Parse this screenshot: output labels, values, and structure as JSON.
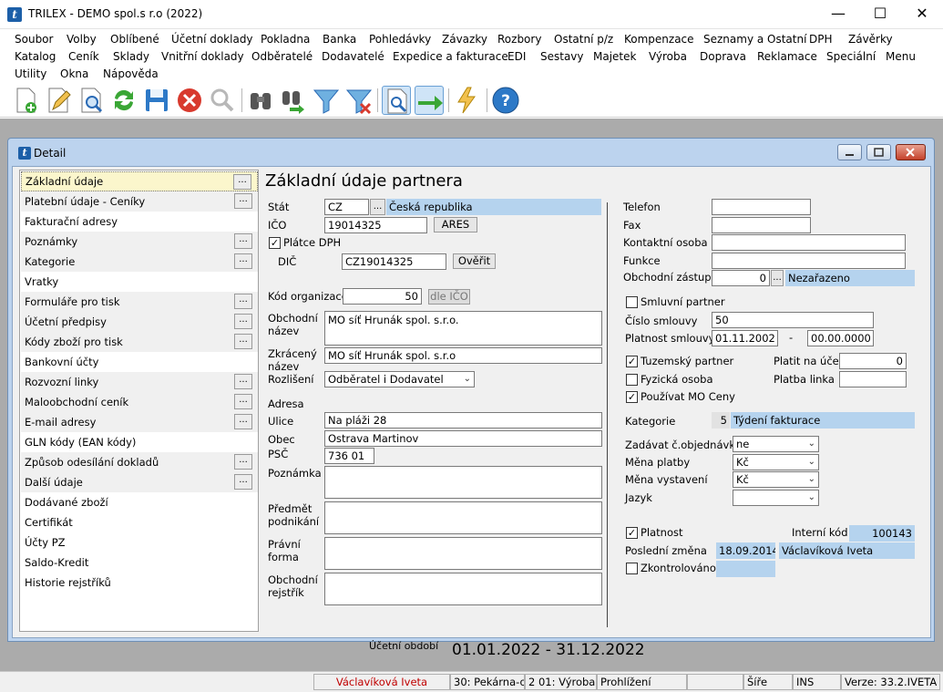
{
  "window": {
    "title": "TRILEX - DEMO spol.s r.o (2022)",
    "app_icon": "t"
  },
  "menu": {
    "row1": [
      "Soubor",
      "Volby",
      "Oblíbené",
      "Účetní doklady",
      "Pokladna",
      "Banka",
      "Pohledávky",
      "Závazky",
      "Rozbory",
      "Ostatní p/z",
      "Kompenzace",
      "Seznamy a Ostatní",
      "DPH",
      "Závěrky"
    ],
    "row2": [
      "Katalog",
      "Ceník",
      "Sklady",
      "Vnitřní doklady",
      "Odběratelé",
      "Dodavatelé",
      "Expedice a fakturace",
      "EDI",
      "Sestavy",
      "Majetek",
      "Výroba",
      "Doprava",
      "Reklamace",
      "Speciální",
      "Menu"
    ],
    "row3": [
      "Utility",
      "Okna",
      "Nápověda"
    ]
  },
  "toolbar": {
    "icons": [
      "new-record-icon",
      "edit-icon",
      "preview-icon",
      "refresh-icon",
      "save-icon",
      "delete-icon",
      "search-disabled-icon",
      "find-icon",
      "find-next-icon",
      "filter-icon",
      "remove-filter-icon",
      "document-search-icon",
      "green-arrow-icon",
      "lightning-icon",
      "help-icon"
    ]
  },
  "detail": {
    "title": "Detail",
    "icon": "t",
    "heading": "Základní údaje partnera",
    "nav": [
      {
        "label": "Základní údaje",
        "btn": "..."
      },
      {
        "label": "Platební údaje - Ceníky",
        "btn": "..."
      },
      {
        "label": "Fakturační adresy",
        "btn": ""
      },
      {
        "label": "Poznámky",
        "btn": "..."
      },
      {
        "label": "Kategorie",
        "btn": "..."
      },
      {
        "label": "Vratky",
        "btn": ""
      },
      {
        "label": "Formuláře pro tisk",
        "btn": "..."
      },
      {
        "label": "Účetní předpisy",
        "btn": "..."
      },
      {
        "label": "Kódy zboží pro tisk",
        "btn": "..."
      },
      {
        "label": "Bankovní účty",
        "btn": ""
      },
      {
        "label": "Rozvozní linky",
        "btn": "..."
      },
      {
        "label": "Maloobchodní ceník",
        "btn": "..."
      },
      {
        "label": "E-mail adresy",
        "btn": "..."
      },
      {
        "label": "GLN kódy (EAN kódy)",
        "btn": ""
      },
      {
        "label": "Způsob odesílání dokladů",
        "btn": "..."
      },
      {
        "label": "Další údaje",
        "btn": "..."
      },
      {
        "label": "Dodávané zboží",
        "btn": ""
      },
      {
        "label": "Certifikát",
        "btn": ""
      },
      {
        "label": "Účty PZ",
        "btn": ""
      },
      {
        "label": "Saldo-Kredit",
        "btn": ""
      },
      {
        "label": "Historie rejstříků",
        "btn": ""
      }
    ],
    "left": {
      "stat_label": "Stát",
      "stat_value": "CZ",
      "stat_btn": "...",
      "stat_name": "Česká republika",
      "ico_label": "IČO",
      "ico_value": "19014325",
      "ares_btn": "ARES",
      "platce_dph_label": "Plátce DPH",
      "platce_dph_checked": "✓",
      "dic_label": "DIČ",
      "dic_value": "CZ19014325",
      "overit_btn": "Ověřit",
      "kod_org_label": "Kód organizace",
      "kod_org_value": "50",
      "dle_ico_btn": "dle IČO",
      "obch_nazev_label": "Obchodní\nnázev",
      "obch_nazev_value": "MO síť Hrunák spol. s.r.o.",
      "zkr_nazev_label": "Zkrácený\nnázev",
      "zkr_nazev_value": "MO síť Hrunák spol. s.r.o",
      "rozliseni_label": "Rozlišení",
      "rozliseni_value": "Odběratel i Dodavatel",
      "adresa_label": "Adresa",
      "ulice_label": "Ulice",
      "ulice_value": "Na pláži 28",
      "obec_label": "Obec",
      "obec_value": "Ostrava Martinov",
      "psc_label": "PSČ",
      "psc_value": "736 01",
      "poznamka_label": "Poznámka",
      "predmet_label": "Předmět\npodnikání",
      "pravni_label": "Právní\nforma",
      "rejstrik_label": "Obchodní\nrejstřík"
    },
    "right": {
      "telefon_label": "Telefon",
      "fax_label": "Fax",
      "kontakt_label": "Kontaktní osoba",
      "funkce_label": "Funkce",
      "zastupce_label": "Obchodní zástupce",
      "zastupce_value": "0",
      "zastupce_btn": "...",
      "zastupce_name": "Nezařazeno",
      "smluvni_label": "Smluvní partner",
      "cislo_smlouvy_label": "Číslo smlouvy",
      "cislo_smlouvy_value": "50",
      "platnost_smlouvy_label": "Platnost smlouvy",
      "platnost_od": "01.11.2002",
      "platnost_dash": "-",
      "platnost_do": "00.00.0000",
      "tuzemsky_label": "Tuzemský partner",
      "tuzemsky_checked": "✓",
      "platit_label": "Platit na účet",
      "platit_value": "0",
      "fyzicka_label": "Fyzická osoba",
      "platba_linka_label": "Platba linka",
      "mo_ceny_label": "Používat MO Ceny",
      "mo_ceny_checked": "✓",
      "kategorie_label": "Kategorie",
      "kategorie_num": "5",
      "kategorie_name": "Týdení fakturace",
      "zadavat_label": "Zadávat č.objednávky",
      "zadavat_value": "ne",
      "mena_platby_label": "Měna platby",
      "mena_platby_value": "Kč",
      "mena_vyst_label": "Měna vystavení",
      "mena_vyst_value": "Kč",
      "jazyk_label": "Jazyk",
      "jazyk_value": "",
      "platnost_label": "Platnost",
      "platnost_checked": "✓",
      "interni_label": "Interní kód",
      "interni_value": "100143",
      "posledni_label": "Poslední změna",
      "posledni_date": "18.09.2014",
      "posledni_user": "Václavíková Iveta",
      "zkontrolovano_label": "Zkontrolováno"
    }
  },
  "period": {
    "label": "Účetní období",
    "value": "01.01.2022 - 31.12.2022"
  },
  "status": {
    "user": "Václavíková Iveta",
    "user_color": "#c00000",
    "p1": "30: Pekárna-ob",
    "p2": "2 01: Výroba pe",
    "p3": "Prohlížení",
    "p4": "",
    "p5": "Šíře",
    "p6": "INS",
    "version": "Verze: 33.2.IVETA"
  }
}
